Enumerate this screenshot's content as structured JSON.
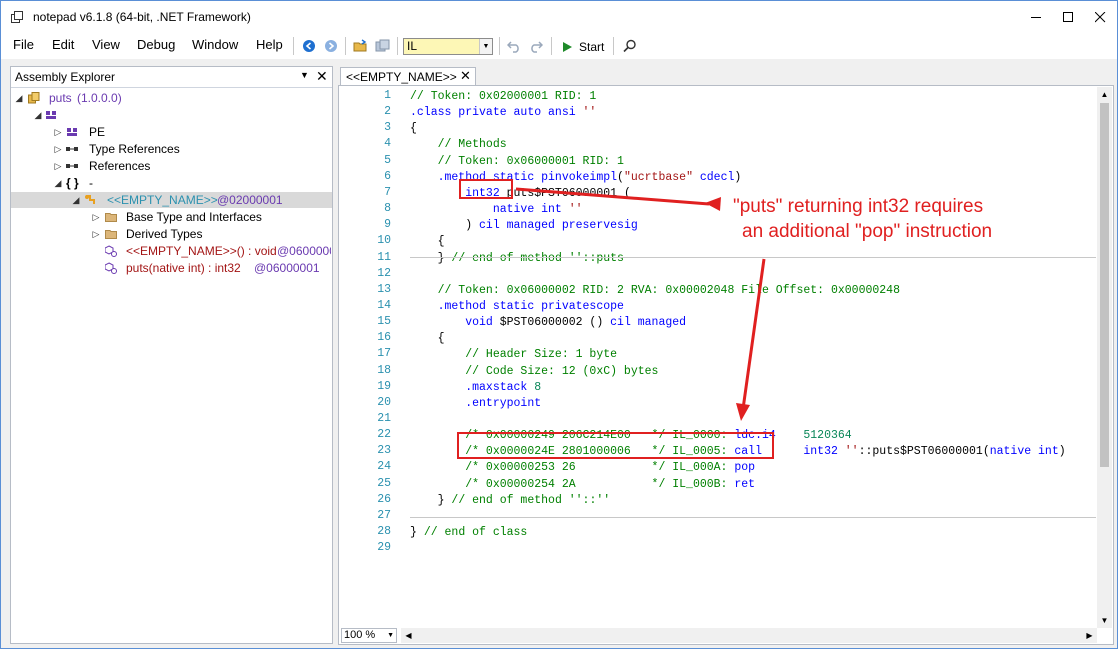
{
  "window": {
    "title": "notepad v6.1.8 (64-bit, .NET Framework)",
    "minimize_icon": "minimize-icon",
    "maximize_icon": "maximize-icon",
    "close_icon": "close-icon"
  },
  "menu": {
    "items": [
      "File",
      "Edit",
      "View",
      "Debug",
      "Window",
      "Help"
    ]
  },
  "toolbar": {
    "language_value": "IL",
    "start_label": "Start"
  },
  "explorer": {
    "title": "Assembly Explorer",
    "tree": [
      {
        "label": "puts",
        "version": "(1.0.0.0)"
      },
      {
        "label": "PE"
      },
      {
        "label": "Type References"
      },
      {
        "label": "References"
      },
      {
        "label": "{ }",
        "suffix": "-"
      },
      {
        "label": "<<EMPTY_NAME>>",
        "token": "@02000001"
      },
      {
        "label": "Base Type and Interfaces"
      },
      {
        "label": "Derived Types"
      },
      {
        "label": "<<EMPTY_NAME>>() : void",
        "token": "@0600000"
      },
      {
        "label": "puts(native int) : int32",
        "token": "@06000001"
      }
    ]
  },
  "editor": {
    "tab_label": "<<EMPTY_NAME>>",
    "zoom": "100 %",
    "lines": [
      {
        "n": "1",
        "parts": [
          [
            "c-com",
            "// Token: 0x02000001 RID: 1"
          ]
        ]
      },
      {
        "n": "2",
        "parts": [
          [
            "c-kw",
            ".class private auto ansi "
          ],
          [
            "c-str",
            "''"
          ]
        ]
      },
      {
        "n": "3",
        "parts": [
          [
            "c-txt",
            "{"
          ]
        ]
      },
      {
        "n": "4",
        "parts": [
          [
            "c-com",
            "    // Methods"
          ]
        ]
      },
      {
        "n": "5",
        "parts": [
          [
            "c-com",
            "    // Token: 0x06000001 RID: 1"
          ]
        ]
      },
      {
        "n": "6",
        "parts": [
          [
            "c-kw",
            "    .method static pinvokeimpl"
          ],
          [
            "c-txt",
            "("
          ],
          [
            "c-str",
            "\"ucrtbase\""
          ],
          [
            "c-txt",
            " "
          ],
          [
            "c-kw",
            "cdecl"
          ],
          [
            "c-txt",
            ")"
          ]
        ]
      },
      {
        "n": "7",
        "parts": [
          [
            "c-kw",
            "        int32 "
          ],
          [
            "c-txt",
            "puts$PST06000001 ("
          ]
        ]
      },
      {
        "n": "8",
        "parts": [
          [
            "c-kw",
            "            native int "
          ],
          [
            "c-str",
            "''"
          ]
        ]
      },
      {
        "n": "9",
        "parts": [
          [
            "c-txt",
            "        ) "
          ],
          [
            "c-kw",
            "cil managed preservesig"
          ]
        ]
      },
      {
        "n": "10",
        "parts": [
          [
            "c-txt",
            "    {"
          ]
        ]
      },
      {
        "n": "11",
        "parts": [
          [
            "c-txt",
            "    } "
          ],
          [
            "c-com",
            "// end of method ''::puts"
          ]
        ]
      },
      {
        "n": "12",
        "parts": [
          [
            "c-txt",
            ""
          ]
        ]
      },
      {
        "n": "13",
        "parts": [
          [
            "c-com",
            "    // Token: 0x06000002 RID: 2 RVA: 0x00002048 File Offset: 0x00000248"
          ]
        ]
      },
      {
        "n": "14",
        "parts": [
          [
            "c-kw",
            "    .method static privatescope"
          ]
        ]
      },
      {
        "n": "15",
        "parts": [
          [
            "c-kw",
            "        void "
          ],
          [
            "c-txt",
            "$PST06000002 () "
          ],
          [
            "c-kw",
            "cil managed"
          ]
        ]
      },
      {
        "n": "16",
        "parts": [
          [
            "c-txt",
            "    {"
          ]
        ]
      },
      {
        "n": "17",
        "parts": [
          [
            "c-com",
            "        // Header Size: 1 byte"
          ]
        ]
      },
      {
        "n": "18",
        "parts": [
          [
            "c-com",
            "        // Code Size: 12 (0xC) bytes"
          ]
        ]
      },
      {
        "n": "19",
        "parts": [
          [
            "c-kw",
            "        .maxstack "
          ],
          [
            "c-num",
            "8"
          ]
        ]
      },
      {
        "n": "20",
        "parts": [
          [
            "c-kw",
            "        .entrypoint"
          ]
        ]
      },
      {
        "n": "21",
        "parts": [
          [
            "c-txt",
            ""
          ]
        ]
      },
      {
        "n": "22",
        "parts": [
          [
            "c-com",
            "        /* 0x00000249 206C214E00   */ IL_0000: "
          ],
          [
            "c-kw",
            "ldc.i4    "
          ],
          [
            "c-num",
            "5120364"
          ]
        ]
      },
      {
        "n": "23",
        "parts": [
          [
            "c-com",
            "        /* 0x0000024E 2801000006   */ IL_0005: "
          ],
          [
            "c-kw",
            "call      int32 "
          ],
          [
            "c-str",
            "''"
          ],
          [
            "c-txt",
            "::puts$PST06000001("
          ],
          [
            "c-kw",
            "native int"
          ],
          [
            "c-txt",
            ")"
          ]
        ]
      },
      {
        "n": "24",
        "parts": [
          [
            "c-com",
            "        /* 0x00000253 26           */ IL_000A: "
          ],
          [
            "c-kw",
            "pop"
          ]
        ]
      },
      {
        "n": "25",
        "parts": [
          [
            "c-com",
            "        /* 0x00000254 2A           */ IL_000B: "
          ],
          [
            "c-kw",
            "ret"
          ]
        ]
      },
      {
        "n": "26",
        "parts": [
          [
            "c-txt",
            "    } "
          ],
          [
            "c-com",
            "// end of method ''::''"
          ]
        ]
      },
      {
        "n": "27",
        "parts": [
          [
            "c-txt",
            ""
          ]
        ]
      },
      {
        "n": "28",
        "parts": [
          [
            "c-txt",
            "} "
          ],
          [
            "c-com",
            "// end of class"
          ]
        ]
      },
      {
        "n": "29",
        "parts": [
          [
            "c-txt",
            ""
          ]
        ]
      }
    ]
  },
  "annotation": {
    "line1": "\"puts\" returning int32 requires",
    "line2": "an additional \"pop\" instruction",
    "color": "#e02020"
  }
}
